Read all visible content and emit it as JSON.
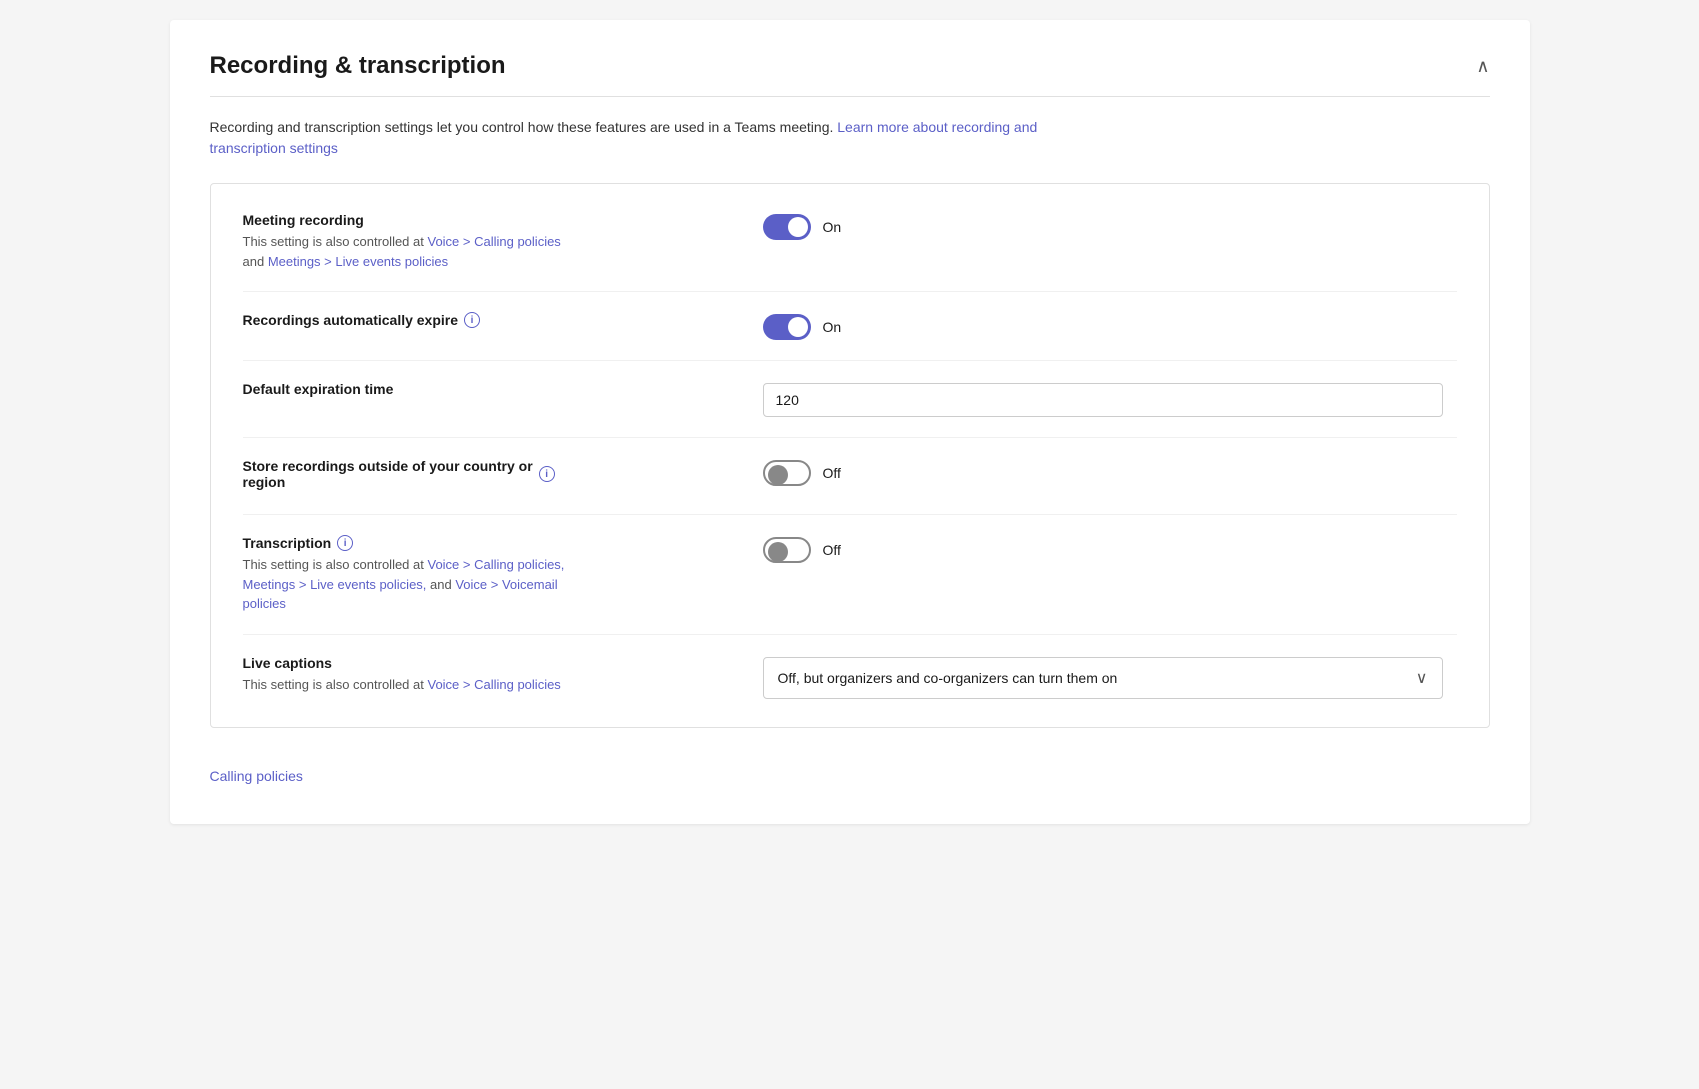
{
  "panel": {
    "title": "Recording & transcription",
    "close_label": "∧",
    "description_text": "Recording and transcription settings let you control how these features are used in a Teams meeting.",
    "description_link_text": "Learn more about recording and transcription settings",
    "description_link2_text": "transcription settings"
  },
  "settings": [
    {
      "id": "meeting-recording",
      "title": "Meeting recording",
      "description_prefix": "This setting is also controlled at",
      "description_links": [
        {
          "text": "Voice > Calling policies",
          "href": "#"
        },
        {
          "text": "and"
        },
        {
          "text": "Meetings > Live events policies",
          "href": "#"
        }
      ],
      "control_type": "toggle",
      "toggle_state": "on",
      "toggle_label": "On",
      "has_info": false
    },
    {
      "id": "recordings-expire",
      "title": "Recordings automatically expire",
      "description_prefix": "",
      "description_links": [],
      "control_type": "toggle",
      "toggle_state": "on",
      "toggle_label": "On",
      "has_info": true
    },
    {
      "id": "default-expiration",
      "title": "Default expiration time",
      "description_prefix": "",
      "description_links": [],
      "control_type": "input",
      "input_value": "120",
      "has_info": false
    },
    {
      "id": "store-outside",
      "title": "Store recordings outside of your country or region",
      "description_prefix": "",
      "description_links": [],
      "control_type": "toggle",
      "toggle_state": "off",
      "toggle_label": "Off",
      "has_info": true
    },
    {
      "id": "transcription",
      "title": "Transcription",
      "description_prefix": "This setting is also controlled at",
      "description_links": [
        {
          "text": "Voice > Calling policies,",
          "href": "#"
        },
        {
          "text": "Meetings > Live events policies,",
          "href": "#"
        },
        {
          "text": "and"
        },
        {
          "text": "Voice > Voicemail policies",
          "href": "#"
        }
      ],
      "control_type": "toggle",
      "toggle_state": "off",
      "toggle_label": "Off",
      "has_info": true
    },
    {
      "id": "live-captions",
      "title": "Live captions",
      "description_prefix": "This setting is also controlled at",
      "description_links": [
        {
          "text": "Voice > Calling policies",
          "href": "#"
        }
      ],
      "control_type": "dropdown",
      "dropdown_value": "Off, but organizers and co-organizers can turn them on",
      "has_info": false
    }
  ],
  "bottom_nav": {
    "label": "Calling policies",
    "href": "#"
  },
  "icons": {
    "close": "∧",
    "info": "i",
    "chevron_down": "∨"
  },
  "colors": {
    "toggle_on": "#5b5fc7",
    "link": "#5b5fc7",
    "border": "#e0e0e0"
  }
}
